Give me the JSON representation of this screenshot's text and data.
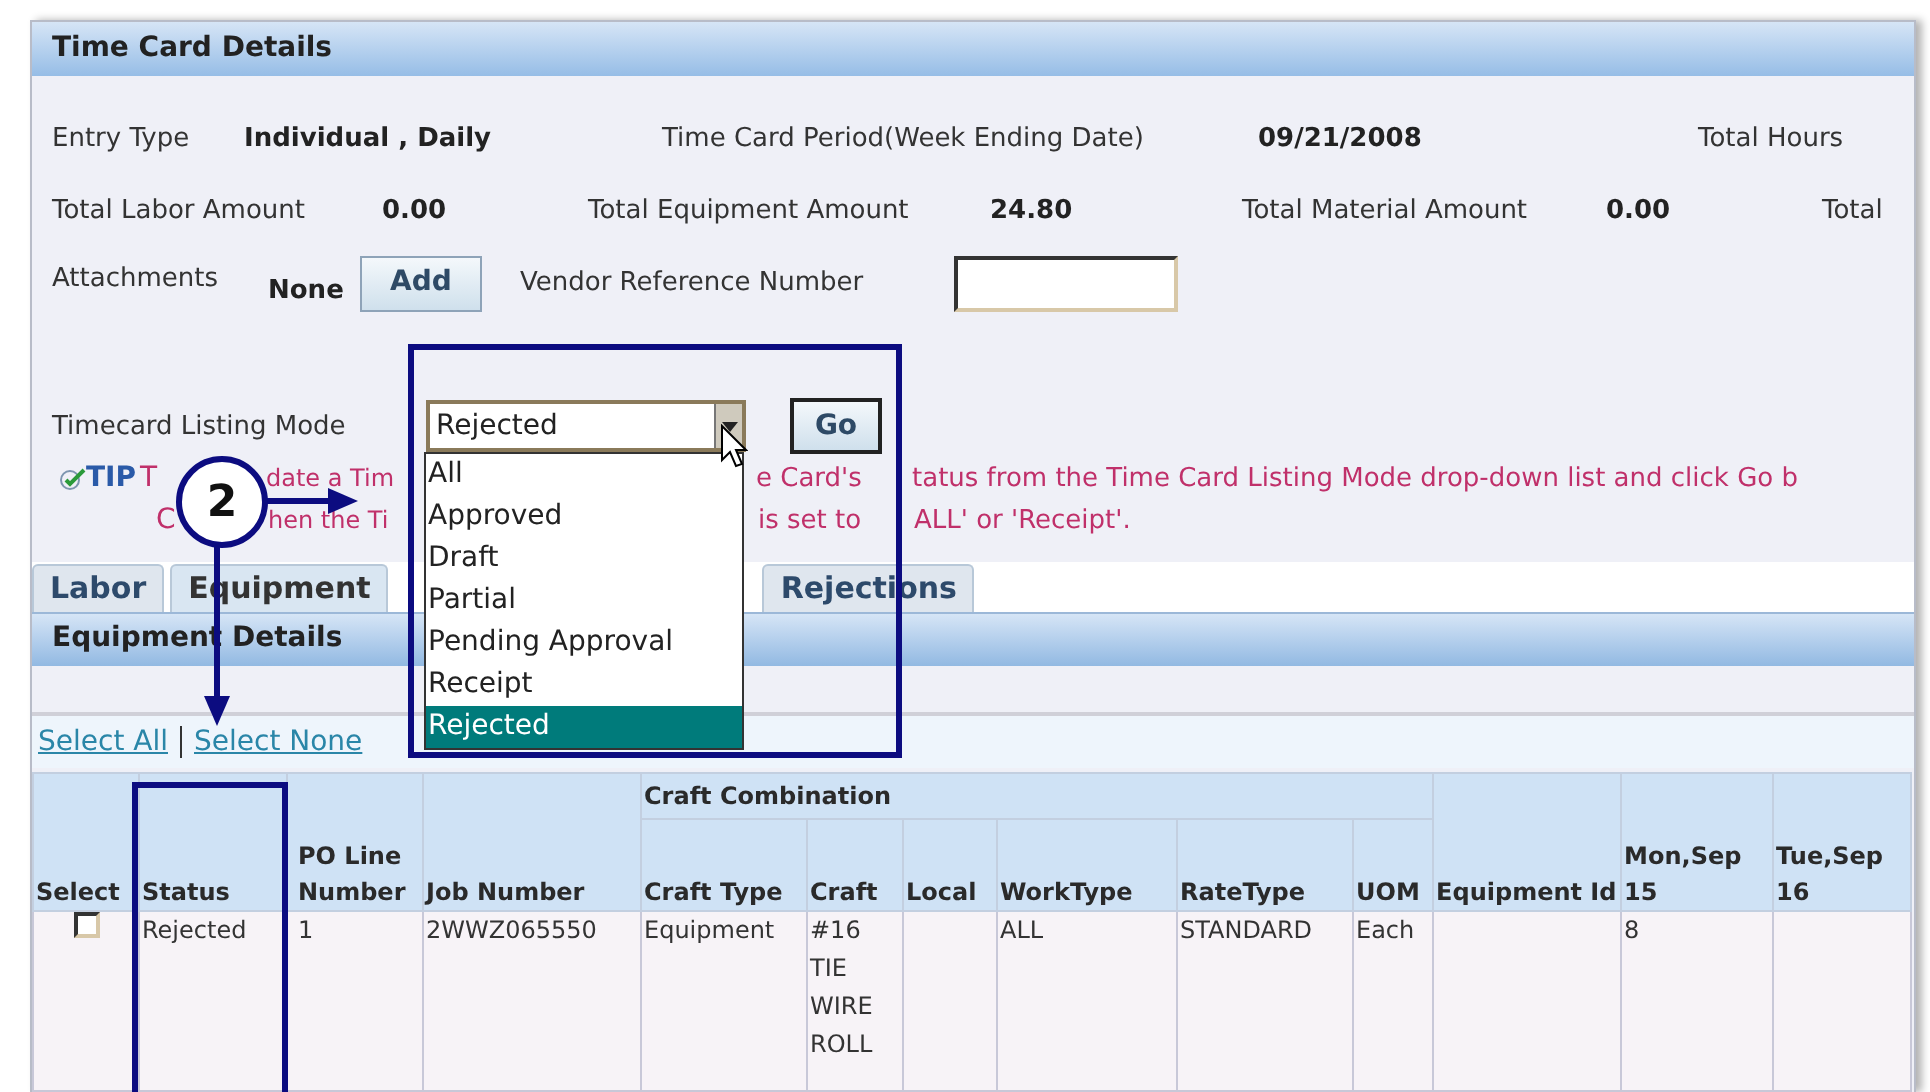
{
  "window": {
    "title": "Time Card Details"
  },
  "summary_rows": [
    [
      {
        "label": "Entry Type",
        "value": "Individual , Daily"
      },
      {
        "label": "Time Card Period(Week Ending Date)",
        "value": "09/21/2008"
      },
      {
        "label": "Total Hours"
      }
    ],
    [
      {
        "label": "Total Labor Amount",
        "value": "0.00"
      },
      {
        "label": "Total Equipment Amount",
        "value": "24.80"
      },
      {
        "label": "Total Material Amount",
        "value": "0.00"
      },
      {
        "label": "Total"
      }
    ]
  ],
  "attachments": {
    "label": "Attachments",
    "value": "None",
    "button": "Add"
  },
  "vendor_reference": {
    "label": "Vendor Reference Number"
  },
  "listing_mode": {
    "label": "Timecard Listing Mode",
    "value": "Rejected",
    "button": "Go",
    "options": [
      {
        "label": "All",
        "selected": false
      },
      {
        "label": "Approved",
        "selected": false
      },
      {
        "label": "Draft",
        "selected": false
      },
      {
        "label": "Partial",
        "selected": false
      },
      {
        "label": "Pending Approval",
        "selected": false
      },
      {
        "label": "Receipt",
        "selected": false
      },
      {
        "label": "Rejected",
        "selected": true
      }
    ]
  },
  "tip": {
    "label": "TIP",
    "lines": [
      [
        "T",
        "date a Tim",
        "e Card's",
        "tatus from the Time Card Listing Mode drop-down list and click Go b"
      ],
      [
        "C",
        "hen the Ti",
        "is set to",
        "ALL' or 'Receipt'."
      ]
    ]
  },
  "tabs": [
    {
      "label": "Labor",
      "selected": false
    },
    {
      "label": "Equipment",
      "selected": true
    },
    {
      "label": "Rejections",
      "selected": false
    }
  ],
  "section": {
    "title": "Equipment Details"
  },
  "selection_links": [
    "Select All",
    "Select None"
  ],
  "table": {
    "group_header": "Craft Combination",
    "columns": [
      "Select",
      "Status",
      "PO Line Number",
      "Job Number",
      "Craft Type",
      "Craft",
      "Local",
      "WorkType",
      "RateType",
      "UOM",
      "Equipment Id",
      "Mon,Sep 15",
      "Tue,Sep 16"
    ],
    "rows": [
      {
        "cells": [
          {
            "checked": false
          },
          "Rejected",
          "1",
          "2WWZ065550",
          "Equipment",
          "#16 TIE WIRE ROLL",
          "",
          "ALL",
          "STANDARD",
          "Each",
          "",
          "8",
          ""
        ]
      }
    ]
  },
  "callout": {
    "number": "2"
  }
}
